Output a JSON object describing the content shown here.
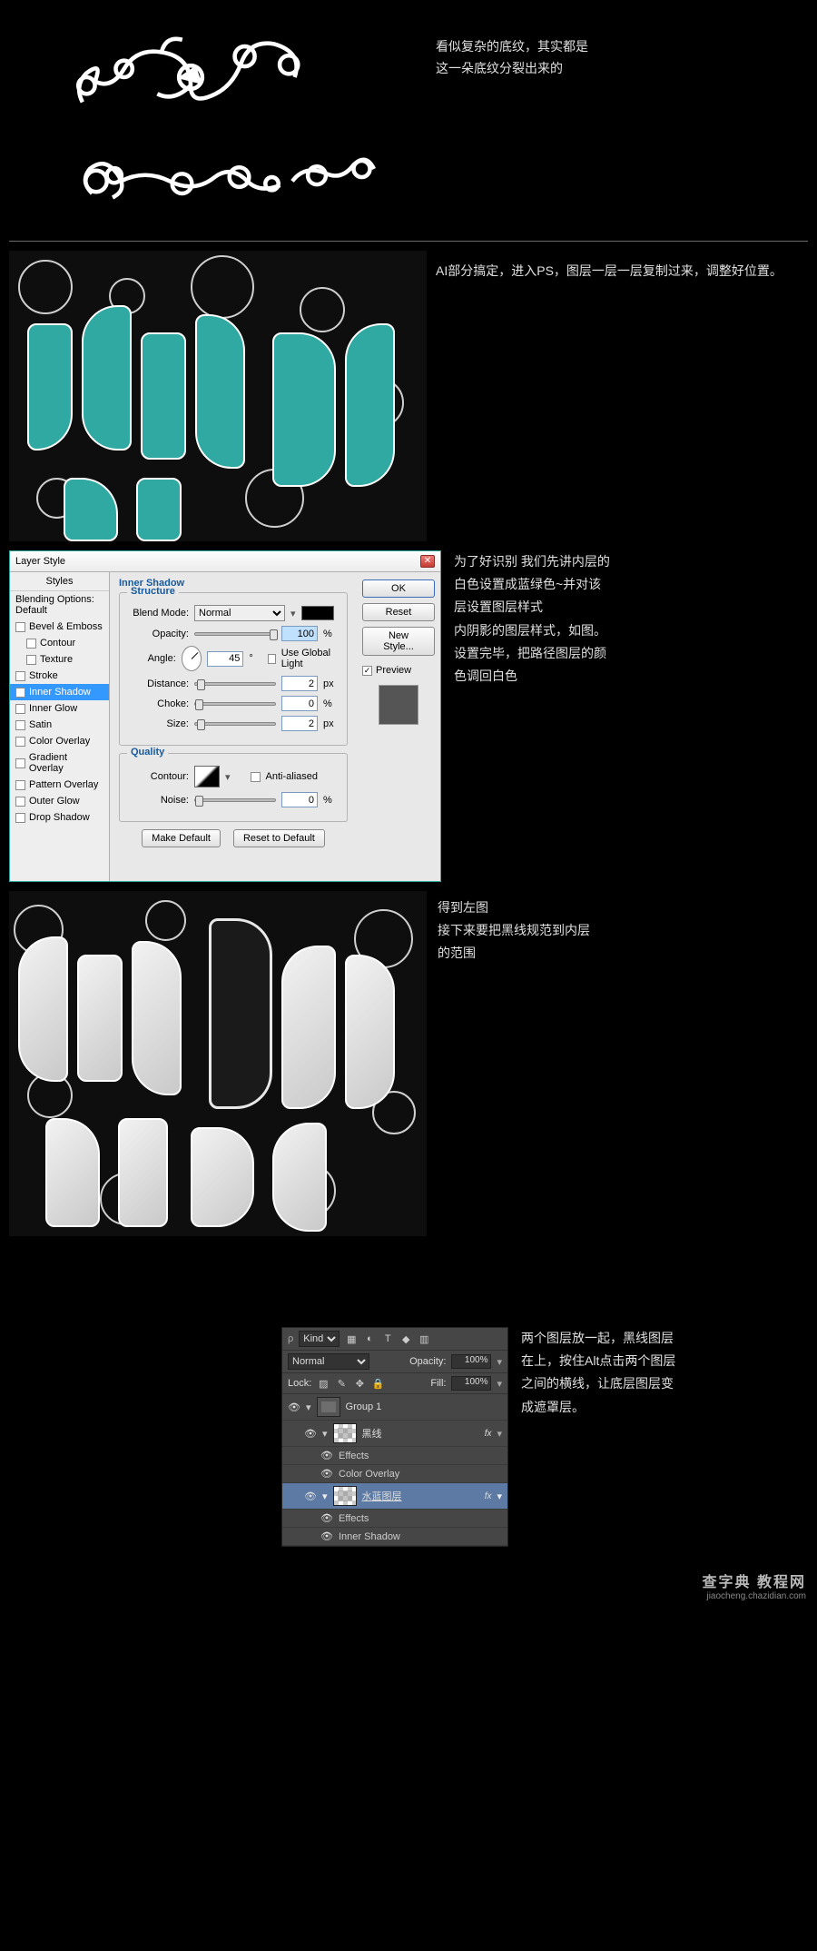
{
  "sec1": {
    "text1": "看似复杂的底纹，其实都是",
    "text2": "这一朵底纹分裂出来的"
  },
  "sec2": {
    "text": "AI部分搞定，进入PS，图层一层一层复制过来，调整好位置。"
  },
  "dlg": {
    "title": "Layer Style",
    "stylesHeader": "Styles",
    "styles": [
      {
        "label": "Blending Options: Default",
        "checked": null
      },
      {
        "label": "Bevel & Emboss",
        "checked": false
      },
      {
        "label": "Contour",
        "checked": false,
        "indent": true
      },
      {
        "label": "Texture",
        "checked": false,
        "indent": true
      },
      {
        "label": "Stroke",
        "checked": false
      },
      {
        "label": "Inner Shadow",
        "checked": true,
        "selected": true
      },
      {
        "label": "Inner Glow",
        "checked": false
      },
      {
        "label": "Satin",
        "checked": false
      },
      {
        "label": "Color Overlay",
        "checked": false
      },
      {
        "label": "Gradient Overlay",
        "checked": false
      },
      {
        "label": "Pattern Overlay",
        "checked": false
      },
      {
        "label": "Outer Glow",
        "checked": false
      },
      {
        "label": "Drop Shadow",
        "checked": false
      }
    ],
    "innerShadowTitle": "Inner Shadow",
    "structure": "Structure",
    "blendMode": "Blend Mode:",
    "blendModeValue": "Normal",
    "opacity": "Opacity:",
    "opacityValue": "100",
    "pct": "%",
    "angle": "Angle:",
    "angleValue": "45",
    "deg": "°",
    "useGlobal": "Use Global Light",
    "distance": "Distance:",
    "distanceValue": "2",
    "px": "px",
    "choke": "Choke:",
    "chokeValue": "0",
    "size": "Size:",
    "sizeValue": "2",
    "quality": "Quality",
    "contour": "Contour:",
    "antiAliased": "Anti-aliased",
    "noise": "Noise:",
    "noiseValue": "0",
    "makeDefault": "Make Default",
    "resetDefault": "Reset to Default",
    "ok": "OK",
    "reset": "Reset",
    "newStyle": "New Style...",
    "preview": "Preview"
  },
  "sec3_text": {
    "l1": "为了好识别 我们先讲内层的",
    "l2": "白色设置成蓝绿色~并对该",
    "l3": "层设置图层样式",
    "l4": "内阴影的图层样式，如图。",
    "l5": "设置完毕，把路径图层的颜",
    "l6": "色调回白色"
  },
  "sec4_text": {
    "l1": "得到左图",
    "l2": "接下来要把黑线规范到内层",
    "l3": "的范围"
  },
  "layers": {
    "kind": "Kind",
    "blend": "Normal",
    "opacityLbl": "Opacity:",
    "opacity": "100%",
    "lock": "Lock:",
    "fillLbl": "Fill:",
    "fill": "100%",
    "group": "Group 1",
    "layer1": "黑线",
    "layer2": "水蓝图层",
    "effects": "Effects",
    "colorOverlay": "Color Overlay",
    "innerShadow": "Inner Shadow",
    "fx": "fx"
  },
  "sec5_text": {
    "l1": "两个图层放一起，黑线图层",
    "l2": "在上，按住Alt点击两个图层",
    "l3": "之间的横线，让底层图层变",
    "l4": "成遮罩层。"
  },
  "watermark": {
    "big": "查字典 教程网",
    "small": "jiaocheng.chazidian.com"
  }
}
